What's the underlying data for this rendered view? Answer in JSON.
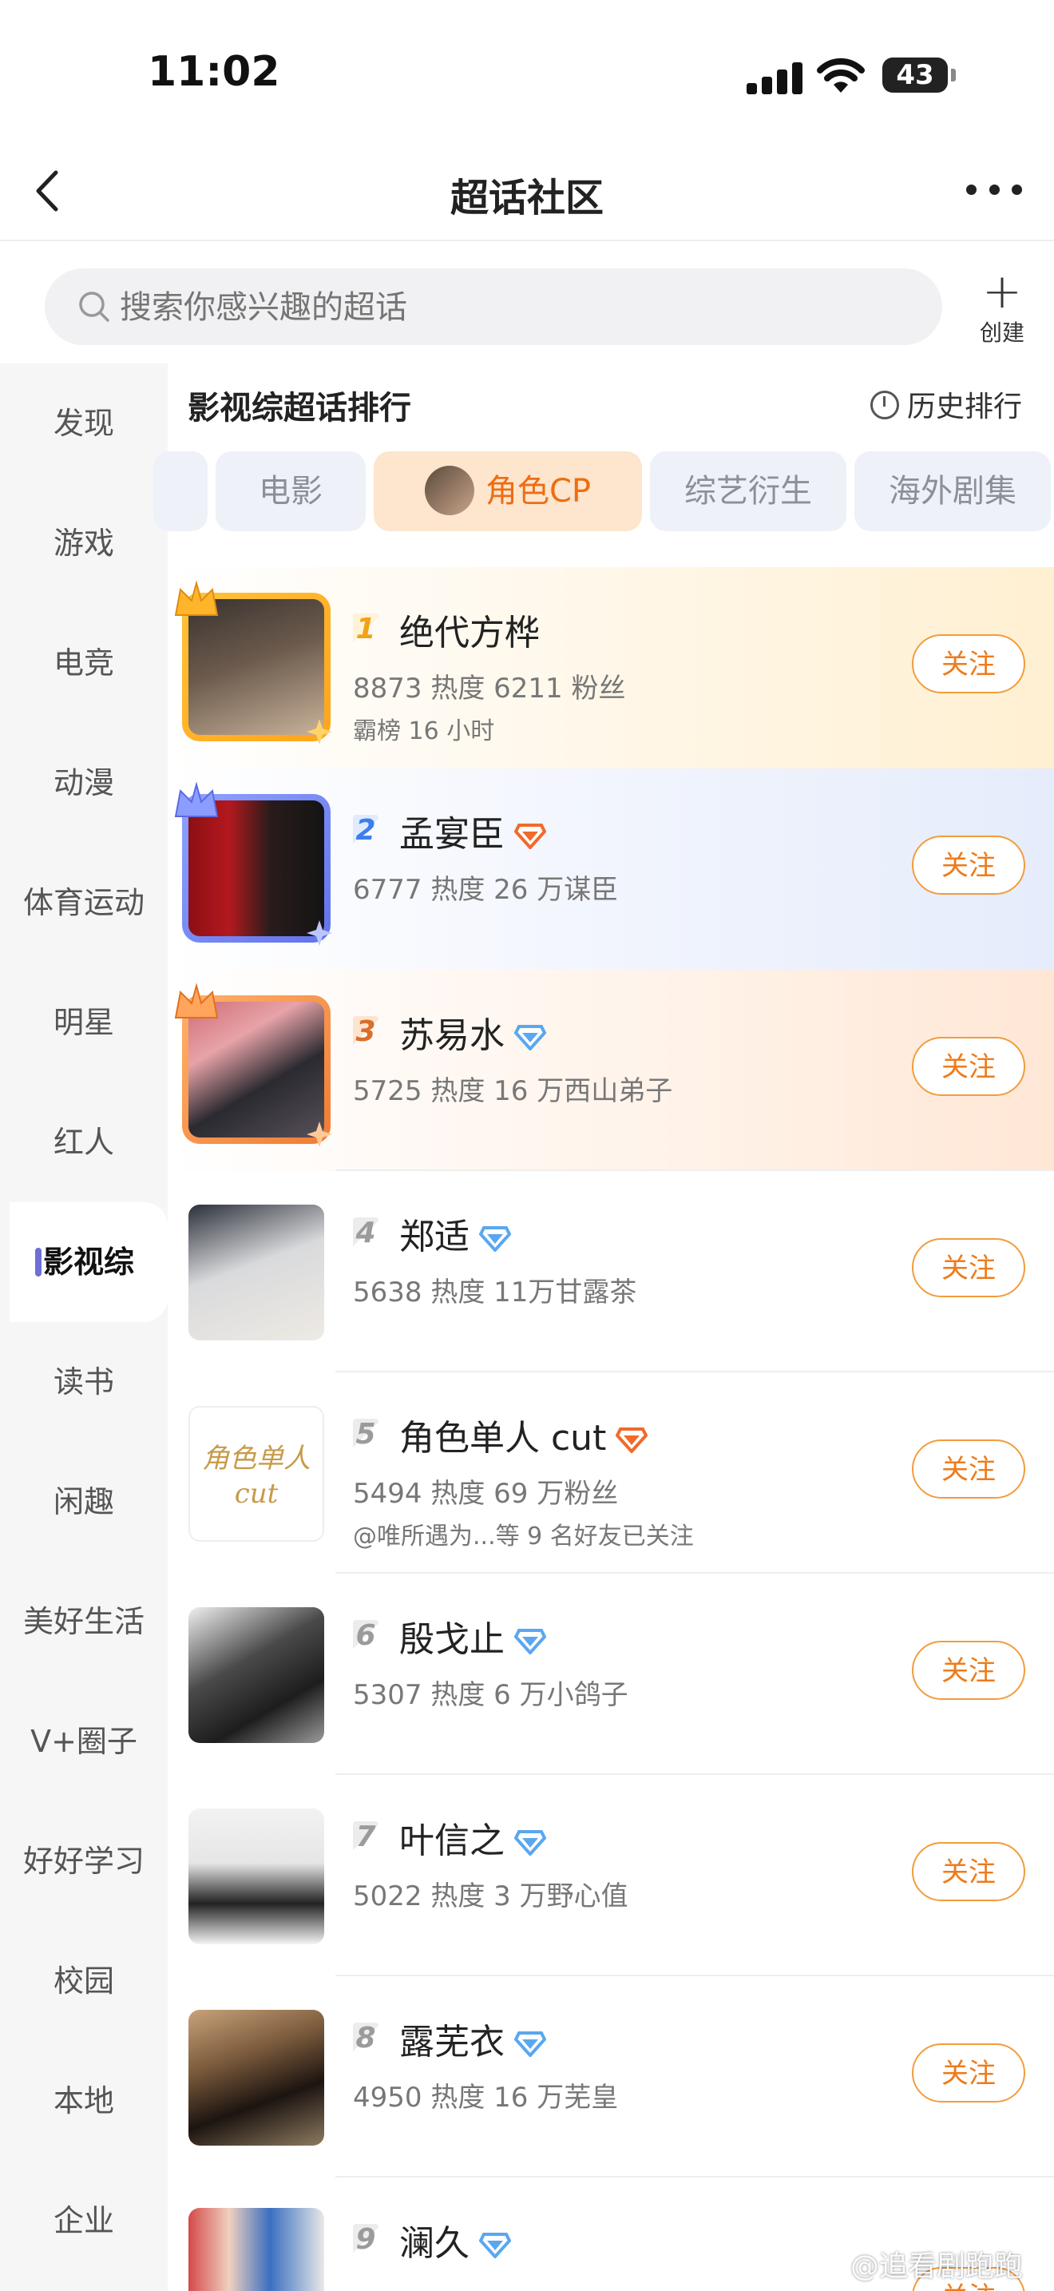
{
  "status_bar": {
    "time": "11:02",
    "battery": "43"
  },
  "nav": {
    "title": "超话社区"
  },
  "search": {
    "placeholder": "搜索你感兴趣的超话",
    "create_label": "创建"
  },
  "sidebar": {
    "items": [
      {
        "label": "发现"
      },
      {
        "label": "游戏"
      },
      {
        "label": "电竞"
      },
      {
        "label": "动漫"
      },
      {
        "label": "体育运动"
      },
      {
        "label": "明星"
      },
      {
        "label": "红人"
      },
      {
        "label": "影视综"
      },
      {
        "label": "读书"
      },
      {
        "label": "闲趣"
      },
      {
        "label": "美好生活"
      },
      {
        "label": "V+圈子"
      },
      {
        "label": "好好学习"
      },
      {
        "label": "校园"
      },
      {
        "label": "本地"
      },
      {
        "label": "企业"
      }
    ],
    "active": "影视综"
  },
  "ranking": {
    "title": "影视综超话排行",
    "history_label": "历史排行"
  },
  "tabs": [
    {
      "label": "电影"
    },
    {
      "label": "角色CP"
    },
    {
      "label": "综艺衍生"
    },
    {
      "label": "海外剧集"
    }
  ],
  "follow_label": "关注",
  "list": [
    {
      "rank": "1",
      "name": "绝代方桦",
      "stats": "8873 热度 6211 粉丝",
      "extra": "霸榜 16 小时",
      "badge": ""
    },
    {
      "rank": "2",
      "name": "孟宴臣",
      "stats": "6777 热度 26 万谋臣",
      "extra": "",
      "badge": "orange-diamond-badge"
    },
    {
      "rank": "3",
      "name": "苏易水",
      "stats": "5725 热度 16 万西山弟子",
      "extra": "",
      "badge": "blue-diamond-badge"
    },
    {
      "rank": "4",
      "name": "郑适",
      "stats": "5638 热度 11万甘露茶",
      "extra": "",
      "badge": "blue-diamond-badge"
    },
    {
      "rank": "5",
      "name": "角色单人 cut",
      "stats": "5494 热度 69 万粉丝",
      "extra": "@唯所遇为...等 9 名好友已关注",
      "badge": "orange-diamond-badge",
      "logo_text": "角色单人cut"
    },
    {
      "rank": "6",
      "name": "殷戈止",
      "stats": "5307 热度 6 万小鸽子",
      "extra": "",
      "badge": "blue-diamond-badge"
    },
    {
      "rank": "7",
      "name": "叶信之",
      "stats": "5022 热度 3 万野心值",
      "extra": "",
      "badge": "blue-diamond-badge"
    },
    {
      "rank": "8",
      "name": "露芜衣",
      "stats": "4950 热度 16 万芜皇",
      "extra": "",
      "badge": "blue-diamond-badge"
    },
    {
      "rank": "9",
      "name": "澜久",
      "stats": "",
      "extra": "",
      "badge": "blue-diamond-badge"
    }
  ],
  "watermark": "@追看剧跑跑",
  "colors": {
    "accent": "#ee7b1b",
    "sidebar_bg": "#f6f6f6",
    "active_tab_bg": "#fde5ce",
    "gold": "#ffb02a",
    "blue": "#6d7df0"
  }
}
